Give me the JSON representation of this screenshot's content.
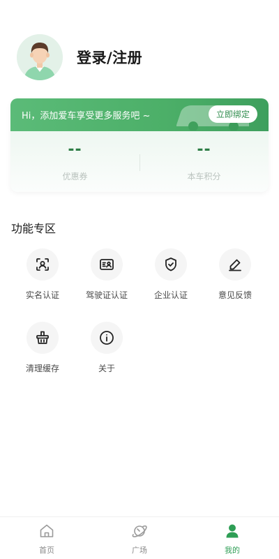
{
  "profile": {
    "login_label": "登录/注册"
  },
  "card": {
    "banner_text": "Hi，添加爱车享受更多服务吧 ~",
    "bind_button": "立即绑定",
    "stats": [
      {
        "value": "--",
        "label": "优惠券"
      },
      {
        "value": "--",
        "label": "本车积分"
      }
    ]
  },
  "functions": {
    "title": "功能专区",
    "items": [
      {
        "label": "实名认证",
        "icon": "face-scan-icon"
      },
      {
        "label": "驾驶证认证",
        "icon": "license-card-icon"
      },
      {
        "label": "企业认证",
        "icon": "shield-check-icon"
      },
      {
        "label": "意见反馈",
        "icon": "edit-pen-icon"
      },
      {
        "label": "清理缓存",
        "icon": "basket-icon"
      },
      {
        "label": "关于",
        "icon": "info-icon"
      }
    ]
  },
  "tabbar": {
    "tabs": [
      {
        "label": "首页",
        "icon": "home-icon"
      },
      {
        "label": "广场",
        "icon": "planet-icon"
      },
      {
        "label": "我的",
        "icon": "user-icon"
      }
    ],
    "active_color": "#2e9e55"
  }
}
